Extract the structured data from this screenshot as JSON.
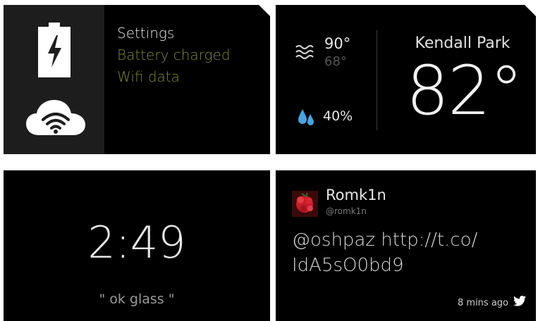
{
  "settings_card": {
    "title": "Settings",
    "items": [
      "Battery charged",
      "Wifi data"
    ],
    "icons": [
      "battery-charging-icon",
      "cloud-wifi-icon"
    ]
  },
  "weather_card": {
    "high": "90°",
    "low": "68°",
    "precipitation": "40%",
    "city": "Kendall Park",
    "temperature": "82°",
    "icons": [
      "waves-icon",
      "raindrops-icon"
    ]
  },
  "clock_card": {
    "time": "2:49",
    "hint": "\" ok glass \""
  },
  "tweet_card": {
    "name": "Romk1n",
    "handle": "@romk1n",
    "body": "@oshpaz http://t.co/ IdA5sO0bd9",
    "timestamp": "8 mins ago",
    "icons": [
      "avatar-icon",
      "twitter-bird-icon"
    ]
  },
  "colors": {
    "card_background": "#000000",
    "accent_olive": "#7c8a3e",
    "rain_blue": "#4aa3df"
  }
}
